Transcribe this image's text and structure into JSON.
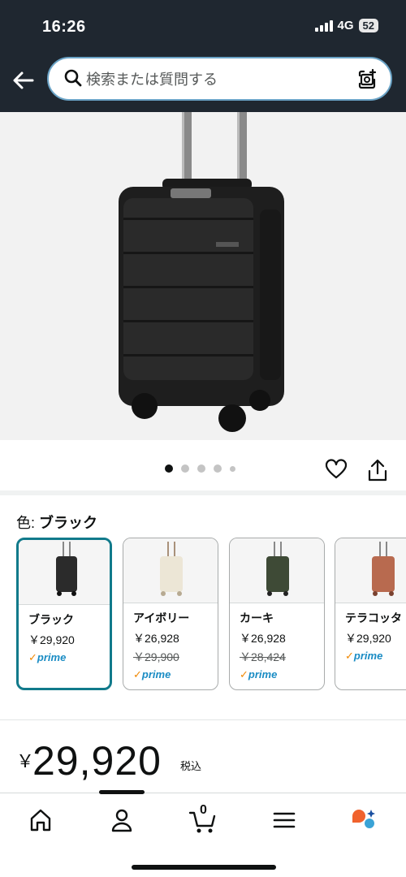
{
  "status": {
    "time": "16:26",
    "network": "4G",
    "battery": "52"
  },
  "search": {
    "placeholder": "検索または質問する"
  },
  "gallery": {
    "dot_count": 5,
    "active_index": 0
  },
  "color_selector": {
    "label": "色: ",
    "selected_name": "ブラック",
    "options": [
      {
        "name": "ブラック",
        "price": "￥29,920",
        "old_price": "",
        "prime": "prime",
        "color": "#2b2b2b"
      },
      {
        "name": "アイボリー",
        "price": "￥26,928",
        "old_price": "￥29,900",
        "prime": "prime",
        "color": "#ece6d6"
      },
      {
        "name": "カーキ",
        "price": "￥26,928",
        "old_price": "￥28,424",
        "prime": "prime",
        "color": "#3e4a36"
      },
      {
        "name": "テラコッタ",
        "price": "￥29,920",
        "old_price": "",
        "prime": "prime",
        "color": "#b86a4f"
      }
    ]
  },
  "price": {
    "currency": "￥",
    "amount": "29,920",
    "tax_label": "税込"
  },
  "nav": {
    "items": [
      "home-icon",
      "account-icon",
      "cart-icon",
      "menu-icon",
      "rufus-icon"
    ],
    "cart_count": "0"
  },
  "colors": {
    "header_bg": "#1f2730",
    "accent": "#117a8b",
    "prime_blue": "#1a8cc4"
  }
}
